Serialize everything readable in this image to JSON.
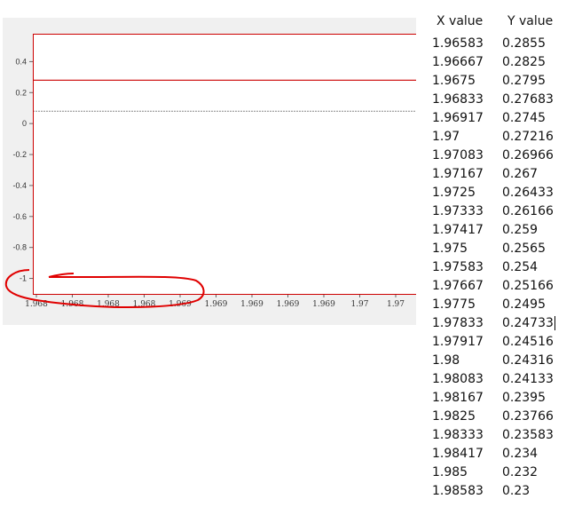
{
  "chart_data": {
    "type": "line",
    "title": "",
    "xlabel": "",
    "ylabel": "",
    "x_tick_labels": [
      "1.968",
      "1.968",
      "1.968",
      "1.968",
      "1.969",
      "1.969",
      "1.969",
      "1.969",
      "1.969",
      "1.97",
      "1.97"
    ],
    "y_tick_labels": [
      "0.4",
      "0.2",
      "0",
      "-0.2",
      "-0.4",
      "-0.6",
      "-0.8",
      "-1"
    ],
    "y_ticks": [
      0.4,
      0.2,
      0,
      -0.2,
      -0.4,
      -0.6,
      -0.8,
      -1
    ],
    "ylim": [
      -1.1,
      0.58
    ],
    "series": [
      {
        "values": [
          0.28,
          0.28
        ],
        "color": "#cc0000",
        "style": "solid"
      },
      {
        "values": [
          0.08,
          0.08
        ],
        "color": "#888888",
        "style": "dashed"
      }
    ],
    "grid": false
  },
  "annotation": {
    "color": "#e00000"
  },
  "colors": {
    "plot_border": "#cc0000",
    "panel_bg": "#f0f0f0"
  },
  "table": {
    "headers": {
      "x": "X value",
      "y": "Y value"
    },
    "rows": [
      {
        "x": "1.96583",
        "y": "0.2855"
      },
      {
        "x": "1.96667",
        "y": "0.2825"
      },
      {
        "x": "1.9675",
        "y": "0.2795"
      },
      {
        "x": "1.96833",
        "y": "0.27683"
      },
      {
        "x": "1.96917",
        "y": "0.2745"
      },
      {
        "x": "1.97",
        "y": "0.27216"
      },
      {
        "x": "1.97083",
        "y": "0.26966"
      },
      {
        "x": "1.97167",
        "y": "0.267"
      },
      {
        "x": "1.9725",
        "y": "0.26433"
      },
      {
        "x": "1.97333",
        "y": "0.26166"
      },
      {
        "x": "1.97417",
        "y": "0.259"
      },
      {
        "x": "1.975",
        "y": "0.2565"
      },
      {
        "x": "1.97583",
        "y": "0.254"
      },
      {
        "x": "1.97667",
        "y": "0.25166"
      },
      {
        "x": "1.9775",
        "y": "0.2495"
      },
      {
        "x": "1.97833",
        "y": "0.24733"
      },
      {
        "x": "1.97917",
        "y": "0.24516"
      },
      {
        "x": "1.98",
        "y": "0.24316"
      },
      {
        "x": "1.98083",
        "y": "0.24133"
      },
      {
        "x": "1.98167",
        "y": "0.2395"
      },
      {
        "x": "1.9825",
        "y": "0.23766"
      },
      {
        "x": "1.98333",
        "y": "0.23583"
      },
      {
        "x": "1.98417",
        "y": "0.234"
      },
      {
        "x": "1.985",
        "y": "0.232"
      },
      {
        "x": "1.98583",
        "y": "0.23"
      }
    ],
    "caret_row": 15
  }
}
